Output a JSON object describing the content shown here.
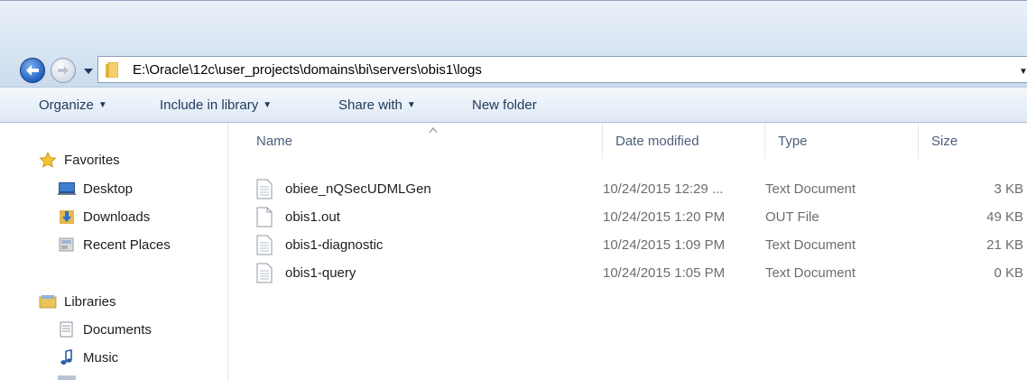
{
  "address": {
    "path": "E:\\Oracle\\12c\\user_projects\\domains\\bi\\servers\\obis1\\logs"
  },
  "toolbar": {
    "organize": "Organize",
    "include_in_library": "Include in library",
    "share_with": "Share with",
    "new_folder": "New folder"
  },
  "navpane": {
    "favorites": "Favorites",
    "desktop": "Desktop",
    "downloads": "Downloads",
    "recent_places": "Recent Places",
    "libraries": "Libraries",
    "documents": "Documents",
    "music": "Music"
  },
  "columns": {
    "name": "Name",
    "date_modified": "Date modified",
    "type": "Type",
    "size": "Size"
  },
  "files": [
    {
      "name": "obiee_nQSecUDMLGen",
      "date": "10/24/2015 12:29 ...",
      "type": "Text Document",
      "size": "3 KB",
      "icon": "text-document-icon"
    },
    {
      "name": "obis1.out",
      "date": "10/24/2015 1:20 PM",
      "type": "OUT File",
      "size": "49 KB",
      "icon": "blank-file-icon"
    },
    {
      "name": "obis1-diagnostic",
      "date": "10/24/2015 1:09 PM",
      "type": "Text Document",
      "size": "21 KB",
      "icon": "text-document-icon"
    },
    {
      "name": "obis1-query",
      "date": "10/24/2015 1:05 PM",
      "type": "Text Document",
      "size": "0 KB",
      "icon": "text-document-icon"
    }
  ],
  "colors": {
    "command_text": "#1e395b",
    "column_header_text": "#4c607a",
    "back_button": "#1f5fbf"
  }
}
